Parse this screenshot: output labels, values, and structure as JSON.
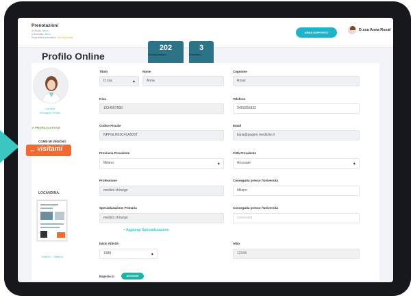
{
  "header": {
    "app_title": "Prenotazioni",
    "meta": [
      {
        "label": "In Studio:",
        "value": "Attivo",
        "tone": "teal"
      },
      {
        "label": "A domicilio:",
        "value": "Attivo",
        "tone": "teal"
      },
      {
        "label": "Reperibilità telematica:",
        "value": "Non Impostata",
        "tone": "yellow"
      }
    ],
    "support_label": "AREA SUPPORTO",
    "user_name": "D.ssa Anna Rossi",
    "user_menu_caret": "∨"
  },
  "page": {
    "title": "Profilo Online",
    "stats": [
      {
        "value": "202",
        "label": "Visualizzazioni"
      },
      {
        "value": "3",
        "label": "Followers"
      }
    ]
  },
  "sidebar": {
    "change_image": "Cambia Immagine Profilo",
    "profile_active": "✔ PROFILO ATTIVO",
    "come_mi_vedono": "COME MI VEDONO",
    "visitami_prefix": "su",
    "visitami_brand": "visitami",
    "locandina_title": "LOCANDINA",
    "download_print": "Scarica – Stampa"
  },
  "form": {
    "titolo": {
      "label": "Titolo",
      "value": "D.ssa"
    },
    "nome": {
      "label": "Nome",
      "value": "Anna"
    },
    "cognome": {
      "label": "Cognome",
      "value": "Rossi"
    },
    "piva": {
      "label": "P.iva",
      "value": "1234567890"
    },
    "telefono": {
      "label": "Telefono",
      "value": "3453256833"
    },
    "codice_fiscale": {
      "label": "Codice Fiscale",
      "value": "NPPGLR93C41A509T"
    },
    "email": {
      "label": "Email",
      "value": "ilaria@pagine mediche.it"
    },
    "provincia": {
      "label": "Provincia Prevalente",
      "value": "Milano"
    },
    "citta": {
      "label": "Città Prevalente",
      "value": "Arconate"
    },
    "professione": {
      "label": "Professione",
      "value": "medico chirurgo"
    },
    "universita1": {
      "label": "Conseguita presso l'Università",
      "value": "Milano"
    },
    "specializzazione": {
      "label": "Specializzazione Primaria",
      "value": "medico chirurgo"
    },
    "universita2": {
      "label": "Conseguita presso l'Università",
      "placeholder": "Università"
    },
    "add_specializzazione": "+ Aggiungi Specializzazione",
    "inizio_attivita": {
      "label": "Inizio Attività",
      "value": "1988"
    },
    "albo": {
      "label": "Albo",
      "value": "12334"
    },
    "esperto_in": {
      "label": "Esperto in",
      "button": "AGGIUNGI"
    }
  }
}
